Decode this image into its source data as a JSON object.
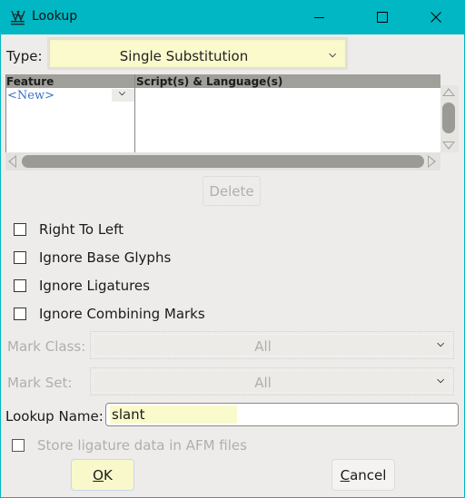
{
  "window": {
    "title": "Lookup",
    "icon": "fontforge-app-icon",
    "controls": {
      "minimize": "minimize",
      "maximize": "maximize",
      "close": "close"
    },
    "accent": "#00b7c3"
  },
  "type": {
    "label": "Type:",
    "value": "Single Substitution"
  },
  "feature_table": {
    "headers": [
      "Feature",
      "Script(s) & Language(s)"
    ],
    "rows": [
      {
        "feature": "<New>",
        "scripts": ""
      }
    ]
  },
  "delete_label": "Delete",
  "flags": [
    {
      "label": "Right To Left",
      "checked": false
    },
    {
      "label": "Ignore Base Glyphs",
      "checked": false
    },
    {
      "label": "Ignore Ligatures",
      "checked": false
    },
    {
      "label": "Ignore Combining Marks",
      "checked": false
    }
  ],
  "mark_class": {
    "label": "Mark Class:",
    "value": "All",
    "disabled": true
  },
  "mark_set": {
    "label": "Mark Set:",
    "value": "All",
    "disabled": true
  },
  "lookup_name": {
    "label": "Lookup Name:",
    "value": "slant"
  },
  "afm": {
    "label": "Store ligature data in AFM files",
    "checked": false,
    "disabled": true
  },
  "buttons": {
    "ok": {
      "mnemonic": "O",
      "rest": "K"
    },
    "cancel": {
      "mnemonic": "C",
      "rest": "ancel"
    }
  },
  "colors": {
    "highlight_yellow": "#fbfacd",
    "new_link_blue": "#3b6fc9",
    "disabled_text": "#b0afab"
  }
}
